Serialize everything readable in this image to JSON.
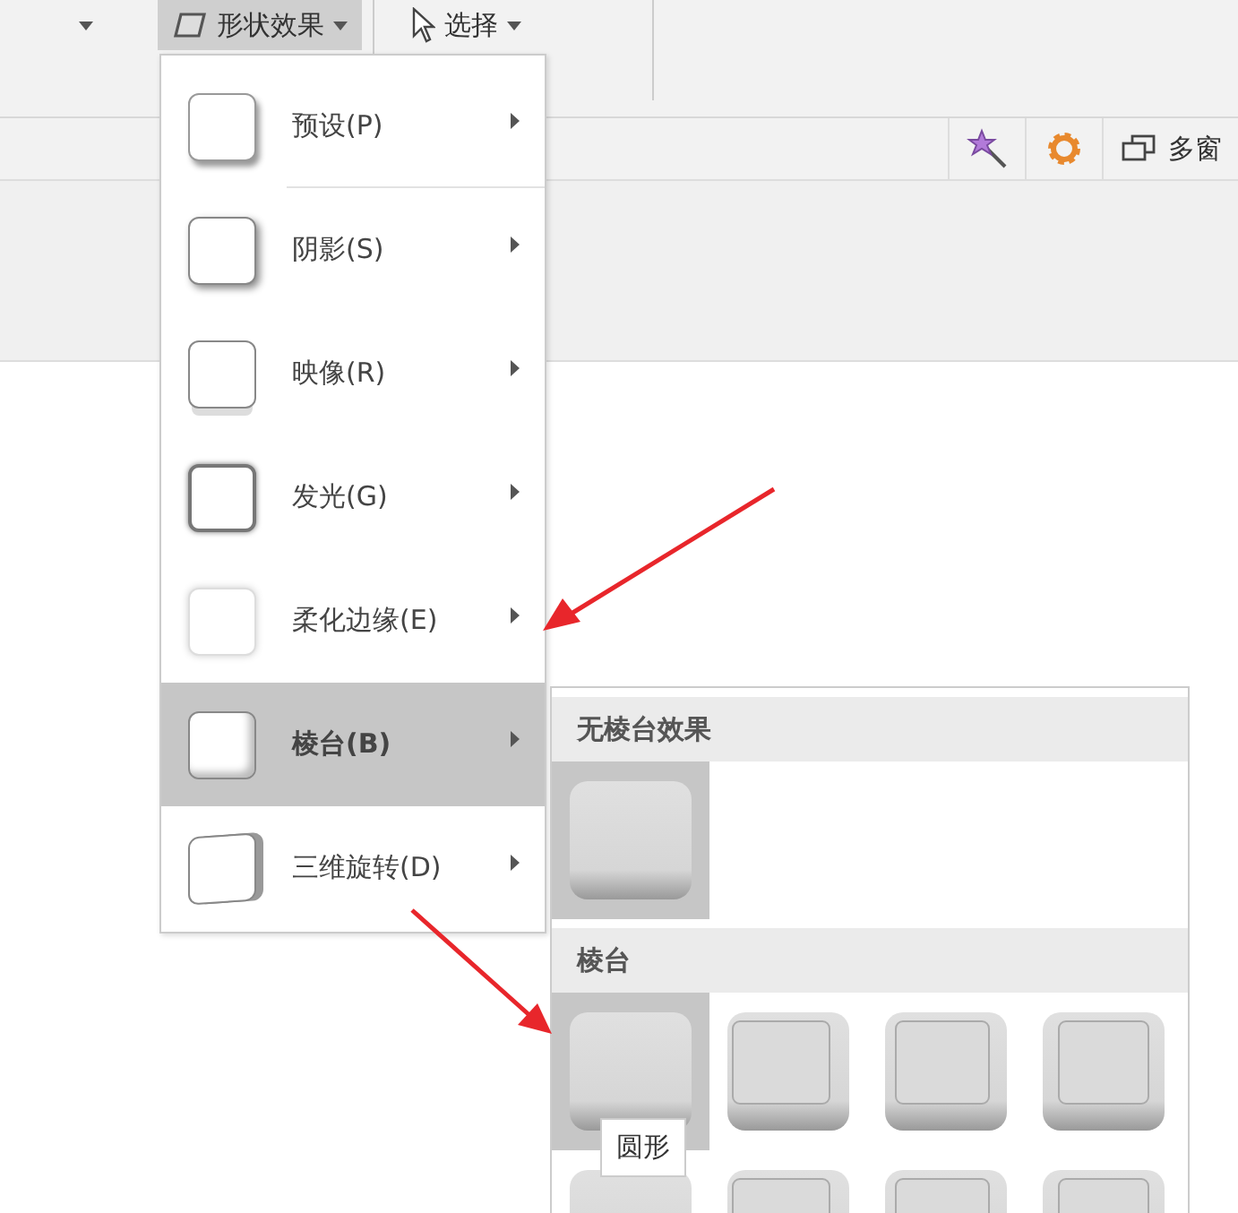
{
  "ribbon": {
    "shape_effects": {
      "label": "形状效果",
      "selected": true
    },
    "select": {
      "label": "选择"
    },
    "multi_window": {
      "label": "多窗"
    }
  },
  "menu": {
    "items": [
      {
        "label": "预设(P)",
        "kind": "preset",
        "selected": false
      },
      {
        "label": "阴影(S)",
        "kind": "shadow",
        "selected": false
      },
      {
        "label": "映像(R)",
        "kind": "reflection",
        "selected": false
      },
      {
        "label": "发光(G)",
        "kind": "glow",
        "selected": false
      },
      {
        "label": "柔化边缘(E)",
        "kind": "soft",
        "selected": false
      },
      {
        "label": "棱台(B)",
        "kind": "bevel",
        "selected": true
      },
      {
        "label": "三维旋转(D)",
        "kind": "rotate",
        "selected": false
      }
    ]
  },
  "submenu": {
    "sections": [
      {
        "title": "无棱台效果",
        "tiles": [
          {
            "selected": true
          }
        ]
      },
      {
        "title": "棱台",
        "tiles": [
          {
            "selected": true
          },
          {
            "selected": false
          },
          {
            "selected": false
          },
          {
            "selected": false
          },
          {
            "selected": false
          },
          {
            "selected": false
          },
          {
            "selected": false
          },
          {
            "selected": false
          }
        ]
      }
    ],
    "tooltip": "圆形"
  }
}
